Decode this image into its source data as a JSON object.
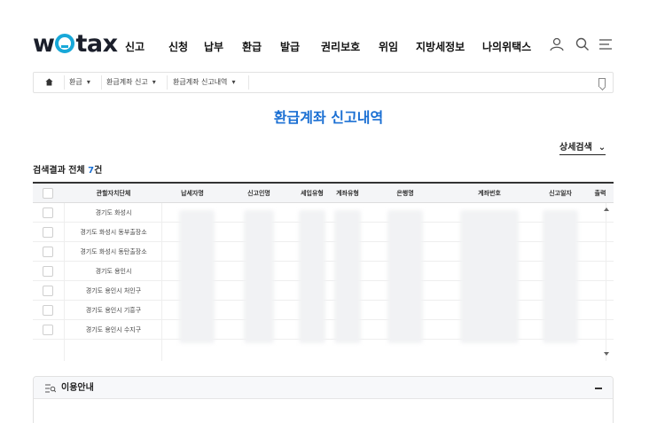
{
  "logo": {
    "prefix": "w",
    "suffix": "tax"
  },
  "nav": [
    "신고",
    "신청",
    "납부",
    "환급",
    "발급",
    "권리보호",
    "위임",
    "지방세정보",
    "나의위택스"
  ],
  "header_icons": [
    "user-icon",
    "search-icon",
    "menu-icon"
  ],
  "breadcrumb": {
    "items": [
      "환급",
      "환급계좌 신고",
      "환급계좌 신고내역"
    ]
  },
  "page_title": "환급계좌 신고내역",
  "detail_search_label": "상세검색",
  "result": {
    "label": "검색결과 전체 ",
    "count": "7",
    "unit": "건"
  },
  "table": {
    "columns": [
      "관할자치단체",
      "납세자명",
      "신고인명",
      "세입유형",
      "계좌유형",
      "은행명",
      "계좌번호",
      "신고일자",
      "출력"
    ],
    "rows": [
      {
        "org": "경기도 화성시"
      },
      {
        "org": "경기도 화성시 동부출장소"
      },
      {
        "org": "경기도 화성시 동탄출장소"
      },
      {
        "org": "경기도 용인시"
      },
      {
        "org": "경기도 용인시 처인구"
      },
      {
        "org": "경기도 용인시 기흥구"
      },
      {
        "org": "경기도 용인시 수지구"
      }
    ]
  },
  "info_panel": {
    "title": "이용안내"
  },
  "colors": {
    "accent": "#1a6fd3",
    "logo_o": "#18a8d8"
  }
}
